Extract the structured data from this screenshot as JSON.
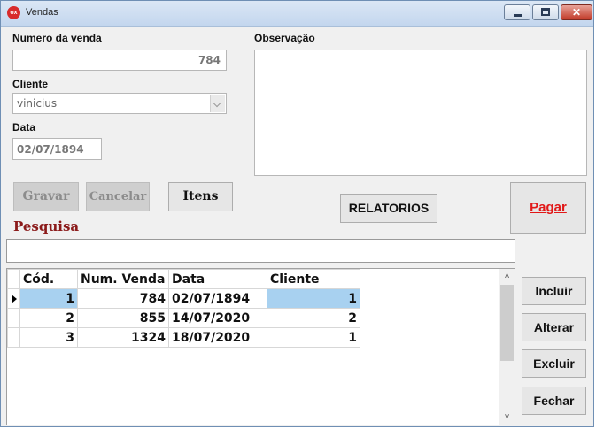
{
  "window": {
    "title": "Vendas",
    "icon": "app-logo-icon",
    "icon_text": "ox"
  },
  "form": {
    "numero_label": "Numero da venda",
    "numero_value": "784",
    "cliente_label": "Cliente",
    "cliente_value": "vinicius",
    "data_label": "Data",
    "data_value": "02/07/1894",
    "observacao_label": "Observação",
    "observacao_value": ""
  },
  "buttons": {
    "gravar": "Gravar",
    "cancelar": "Cancelar",
    "itens": "Itens",
    "relatorios": "RELATORIOS",
    "pagar": "Pagar",
    "incluir": "Incluir",
    "alterar": "Alterar",
    "excluir": "Excluir",
    "fechar": "Fechar"
  },
  "search": {
    "label": "Pesquisa",
    "value": ""
  },
  "grid": {
    "columns": [
      "Cód.",
      "Num. Venda",
      "Data",
      "Cliente"
    ],
    "rows": [
      {
        "cod": "1",
        "num_venda": "784",
        "data": "02/07/1894",
        "cliente": "1"
      },
      {
        "cod": "2",
        "num_venda": "855",
        "data": "14/07/2020",
        "cliente": "2"
      },
      {
        "cod": "3",
        "num_venda": "1324",
        "data": "18/07/2020",
        "cliente": "1"
      }
    ],
    "selected_row": 0
  },
  "colors": {
    "selection": "#a8d1f0",
    "pagar_text": "#e11818",
    "pesquisa_label": "#8b1a1a"
  }
}
